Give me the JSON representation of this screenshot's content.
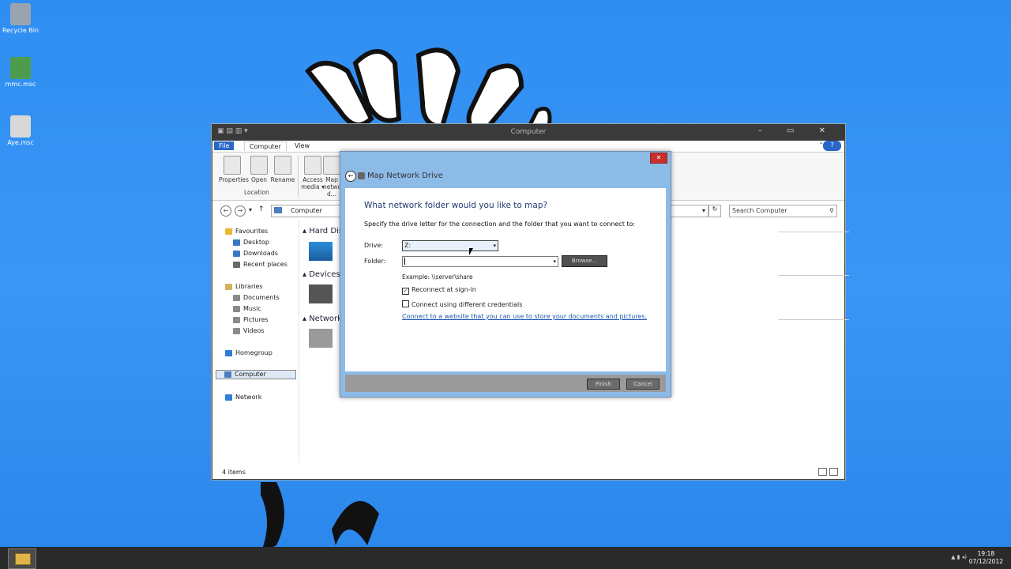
{
  "desktop": {
    "icons": [
      {
        "label": "Recycle Bin",
        "color": "#9aa4b0"
      },
      {
        "label": "mmc.msc",
        "color": "#4c9c4c"
      },
      {
        "label": "Aye.msc",
        "color": "#d8d8d8"
      }
    ]
  },
  "explorer": {
    "title": "Computer",
    "quick_access": "▣ ▤ ▥ ▾",
    "window_controls": "– ▭ ✕",
    "tabs": [
      {
        "label": "File"
      },
      {
        "label": "Computer"
      },
      {
        "label": "View"
      }
    ],
    "ribbon": {
      "buttons": [
        {
          "label": "Properties"
        },
        {
          "label": "Open"
        },
        {
          "label": "Rename"
        },
        {
          "label": "Access media ▾"
        },
        {
          "label": "Map network d..."
        }
      ],
      "group_label": "Location"
    },
    "address": {
      "path": "Computer",
      "search_placeholder": "Search Computer"
    },
    "nav_icons": {
      "back": "←",
      "forward": "→",
      "recent": "▾",
      "up": "↑",
      "refresh": "↻",
      "search": "⚲",
      "dropdown": "▾"
    },
    "navpane": {
      "favourites": "Favourites",
      "fav_items": [
        "Desktop",
        "Downloads",
        "Recent places"
      ],
      "libraries": "Libraries",
      "lib_items": [
        "Documents",
        "Music",
        "Pictures",
        "Videos"
      ],
      "homegroup": "Homegroup",
      "computer": "Computer",
      "network": "Network"
    },
    "content": {
      "groups": [
        {
          "label": "Hard Disk Drives"
        },
        {
          "label": "Devices with Removable Storage"
        },
        {
          "label": "Network Locations"
        }
      ]
    },
    "status": "4 items"
  },
  "dialog": {
    "title": "Map Network Drive",
    "close": "✕",
    "back": "←",
    "question": "What network folder would you like to map?",
    "instruction": "Specify the drive letter for the connection and the folder that you want to connect to:",
    "drive_label": "Drive:",
    "drive_value": "Z:",
    "folder_label": "Folder:",
    "folder_value": "",
    "browse_label": "Browse...",
    "example": "Example: \\\\server\\share",
    "reconnect_label": "Reconnect at sign-in",
    "reconnect_checked": true,
    "credentials_label": "Connect using different credentials",
    "credentials_checked": false,
    "link": "Connect to a website that you can use to store your documents and pictures.",
    "finish_label": "Finish",
    "cancel_label": "Cancel"
  },
  "taskbar": {
    "time": "19:18",
    "date": "07/12/2012",
    "tray": "▲ ▮ ◂)"
  }
}
